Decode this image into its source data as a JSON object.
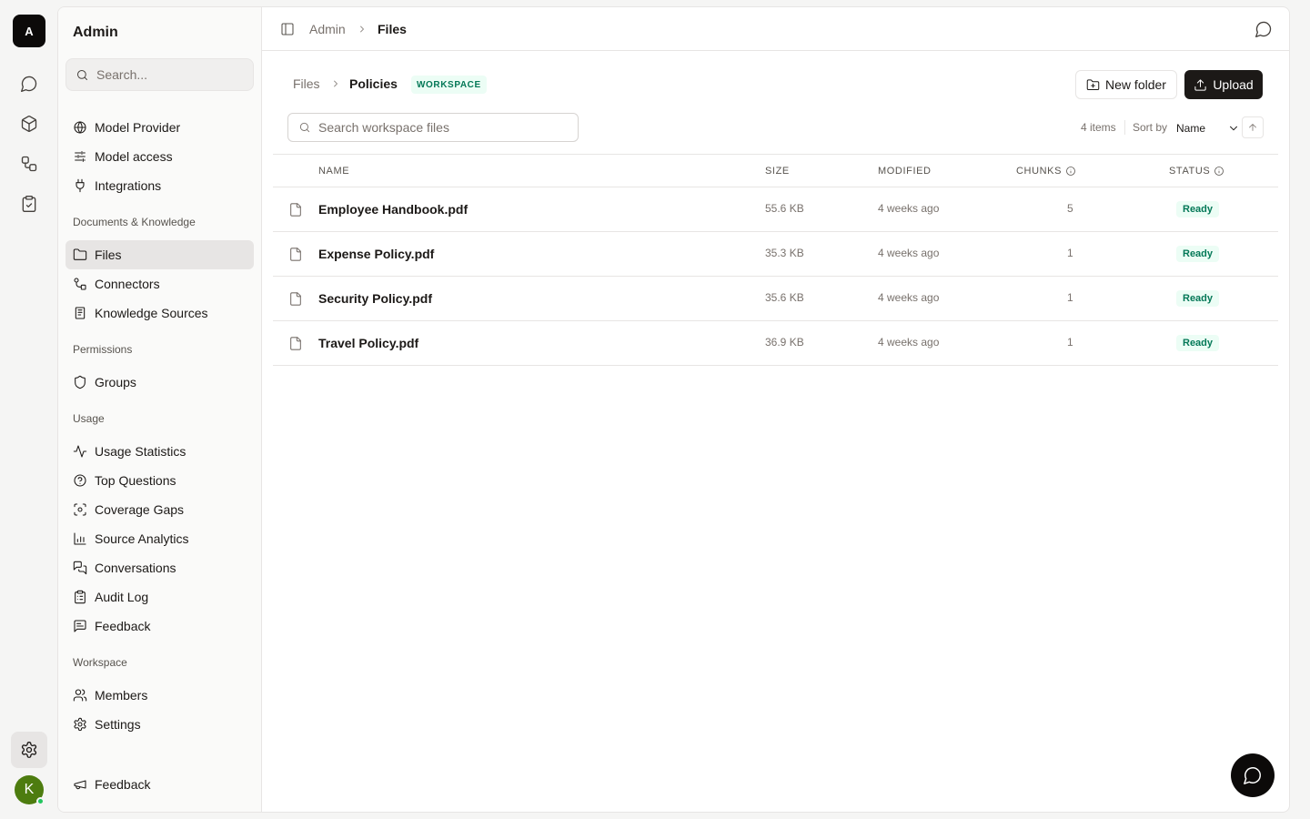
{
  "rail": {
    "logo_letter": "A",
    "icons": [
      "chat-icon",
      "box-icon",
      "workflow-icon",
      "clipboard-check-icon"
    ],
    "settings_icon": "gear-icon",
    "avatar_letter": "K"
  },
  "sidebar": {
    "title": "Admin",
    "search_placeholder": "Search...",
    "top_items": [
      {
        "label": "Model Provider",
        "icon": "globe-icon"
      },
      {
        "label": "Model access",
        "icon": "sliders-icon"
      },
      {
        "label": "Integrations",
        "icon": "plug-icon"
      }
    ],
    "sections": [
      {
        "title": "Documents & Knowledge",
        "items": [
          {
            "label": "Files",
            "icon": "folder-icon",
            "active": true
          },
          {
            "label": "Connectors",
            "icon": "connectors-icon"
          },
          {
            "label": "Knowledge Sources",
            "icon": "book-icon"
          }
        ]
      },
      {
        "title": "Permissions",
        "items": [
          {
            "label": "Groups",
            "icon": "shield-icon"
          }
        ]
      },
      {
        "title": "Usage",
        "items": [
          {
            "label": "Usage Statistics",
            "icon": "activity-icon"
          },
          {
            "label": "Top Questions",
            "icon": "question-circle-icon"
          },
          {
            "label": "Coverage Gaps",
            "icon": "scan-icon"
          },
          {
            "label": "Source Analytics",
            "icon": "bar-chart-icon"
          },
          {
            "label": "Conversations",
            "icon": "messages-icon"
          },
          {
            "label": "Audit Log",
            "icon": "clipboard-list-icon"
          },
          {
            "label": "Feedback",
            "icon": "message-square-text-icon"
          }
        ]
      },
      {
        "title": "Workspace",
        "items": [
          {
            "label": "Members",
            "icon": "users-icon"
          },
          {
            "label": "Settings",
            "icon": "gear-icon"
          }
        ]
      }
    ],
    "footer_item": {
      "label": "Feedback",
      "icon": "megaphone-icon"
    }
  },
  "topbar": {
    "breadcrumb_root": "Admin",
    "breadcrumb_current": "Files"
  },
  "files_header": {
    "breadcrumb_root": "Files",
    "breadcrumb_current": "Policies",
    "badge": "WORKSPACE",
    "new_folder_label": "New folder",
    "upload_label": "Upload"
  },
  "filters": {
    "search_placeholder": "Search workspace files",
    "items_count": "4 items",
    "sort_label": "Sort by",
    "sort_value": "Name"
  },
  "table": {
    "columns": {
      "name": "NAME",
      "size": "SIZE",
      "modified": "MODIFIED",
      "chunks": "CHUNKS",
      "status": "STATUS"
    },
    "rows": [
      {
        "name": "Employee Handbook.pdf",
        "size": "55.6 KB",
        "modified": "4 weeks ago",
        "chunks": "5",
        "status": "Ready"
      },
      {
        "name": "Expense Policy.pdf",
        "size": "35.3 KB",
        "modified": "4 weeks ago",
        "chunks": "1",
        "status": "Ready"
      },
      {
        "name": "Security Policy.pdf",
        "size": "35.6 KB",
        "modified": "4 weeks ago",
        "chunks": "1",
        "status": "Ready"
      },
      {
        "name": "Travel Policy.pdf",
        "size": "36.9 KB",
        "modified": "4 weeks ago",
        "chunks": "1",
        "status": "Ready"
      }
    ]
  },
  "colors": {
    "accent_dark": "#1c1917",
    "status_ready_bg": "#ecfdf5",
    "status_ready_fg": "#047857",
    "avatar_bg": "#4d7c0f"
  }
}
